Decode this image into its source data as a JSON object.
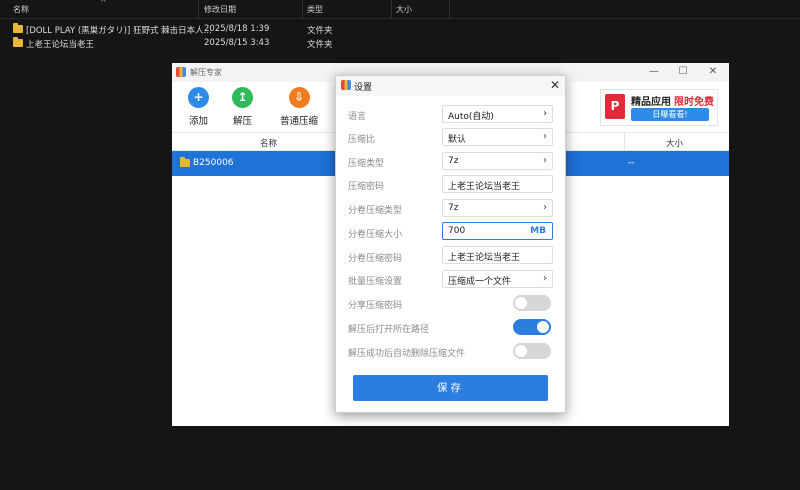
{
  "explorer": {
    "columns": {
      "name": "名称",
      "date": "修改日期",
      "type": "类型",
      "size": "大小"
    },
    "sort_caret": "^",
    "rows": [
      {
        "name": "[DOLL PLAY (黒巣ガタリ)] 狂野式 棘击日本人...",
        "date": "2025/8/18 1:39",
        "type": "文件夹"
      },
      {
        "name": "上老王论坛当老王",
        "date": "2025/8/15 3:43",
        "type": "文件夹"
      }
    ]
  },
  "app": {
    "title": "解压专家",
    "window_buttons": {
      "min": "—",
      "max": "☐",
      "close": "✕"
    },
    "toolbar": [
      {
        "label": "添加",
        "icon": "+",
        "color": "#2f8be8"
      },
      {
        "label": "解压",
        "icon": "↥",
        "color": "#2fba5a"
      },
      {
        "label": "普通压缩",
        "icon": "⇩",
        "color": "#f07a1e"
      }
    ],
    "ad": {
      "logo": "P",
      "title1": "精品应用",
      "title2": "限时免费",
      "button": "日曝看看!"
    },
    "list_header": {
      "name": "名称",
      "size": "大小"
    },
    "selected_row": {
      "name": "B250006",
      "size": "--"
    }
  },
  "dialog": {
    "title": "设置",
    "close": "✕",
    "rows": [
      {
        "label": "语言",
        "value": "Auto(自动)",
        "kind": "select"
      },
      {
        "label": "压缩比",
        "value": "默认",
        "kind": "select"
      },
      {
        "label": "压缩类型",
        "value": "7z",
        "kind": "select"
      },
      {
        "label": "压缩密码",
        "value": "上老王论坛当老王",
        "kind": "text"
      },
      {
        "label": "分卷压缩类型",
        "value": "7z",
        "kind": "select"
      },
      {
        "label": "分卷压缩大小",
        "value": "700",
        "unit": "MB",
        "kind": "number"
      },
      {
        "label": "分卷压缩密码",
        "value": "上老王论坛当老王",
        "kind": "text"
      },
      {
        "label": "批量压缩设置",
        "value": "压缩成一个文件",
        "kind": "select"
      }
    ],
    "toggles": [
      {
        "label": "分享压缩密码",
        "on": false
      },
      {
        "label": "解压后打开所在路径",
        "on": true
      },
      {
        "label": "解压成功后自动删除压缩文件",
        "on": false
      }
    ],
    "save": "保存",
    "chevron": "›"
  }
}
